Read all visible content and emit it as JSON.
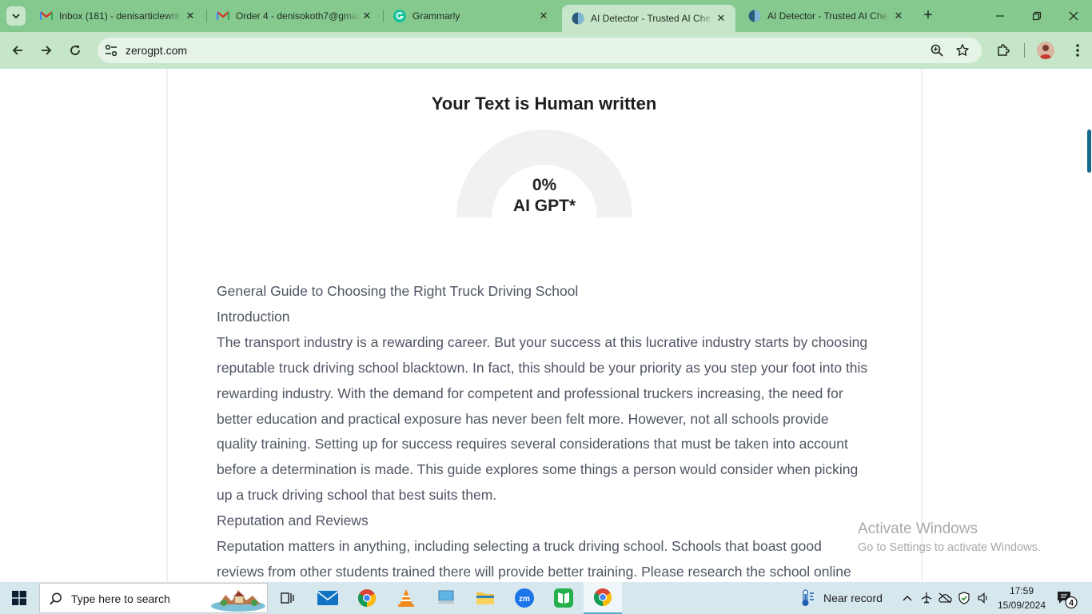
{
  "tabs": [
    {
      "title": "Inbox (181) - denisarticlewrit",
      "icon": "gmail-icon"
    },
    {
      "title": "Order 4 - denisokoth7@gmail",
      "icon": "gmail-icon"
    },
    {
      "title": "Grammarly",
      "icon": "grammarly-icon"
    },
    {
      "title": "AI Detector - Trusted AI Che",
      "icon": "zerogpt-icon",
      "active": true
    },
    {
      "title": "AI Detector - Trusted AI Che",
      "icon": "zerogpt-icon"
    }
  ],
  "address_bar": {
    "url": "zerogpt.com"
  },
  "result": {
    "title": "Your Text is Human written",
    "percent": "0%",
    "label": "AI GPT*",
    "ai_fraction": 0
  },
  "document": {
    "paragraphs": [
      "General Guide to Choosing the Right Truck Driving School",
      "Introduction",
      "The transport industry is a rewarding career. But your success at this lucrative industry starts by choosing reputable truck driving school blacktown. In fact, this should be your priority as you step your foot into this rewarding industry. With the demand for competent and professional truckers increasing, the need for better education and practical exposure has never been felt more. However, not all schools provide quality training. Setting up for success requires several considerations that must be taken into account before a determination is made. This guide explores some things a person would consider when picking up a truck driving school that best suits them.",
      "Reputation and Reviews",
      "Reputation matters in anything, including selecting a truck driving school. Schools that boast good reviews from other students trained there will provide better training. Please research the school online"
    ]
  },
  "watermark": {
    "line1": "Activate Windows",
    "line2": "Go to Settings to activate Windows."
  },
  "taskbar": {
    "search_placeholder": "Type here to search",
    "weather_text": "Near record",
    "time": "17:59",
    "date": "15/09/2024",
    "notification_count": "4"
  }
}
